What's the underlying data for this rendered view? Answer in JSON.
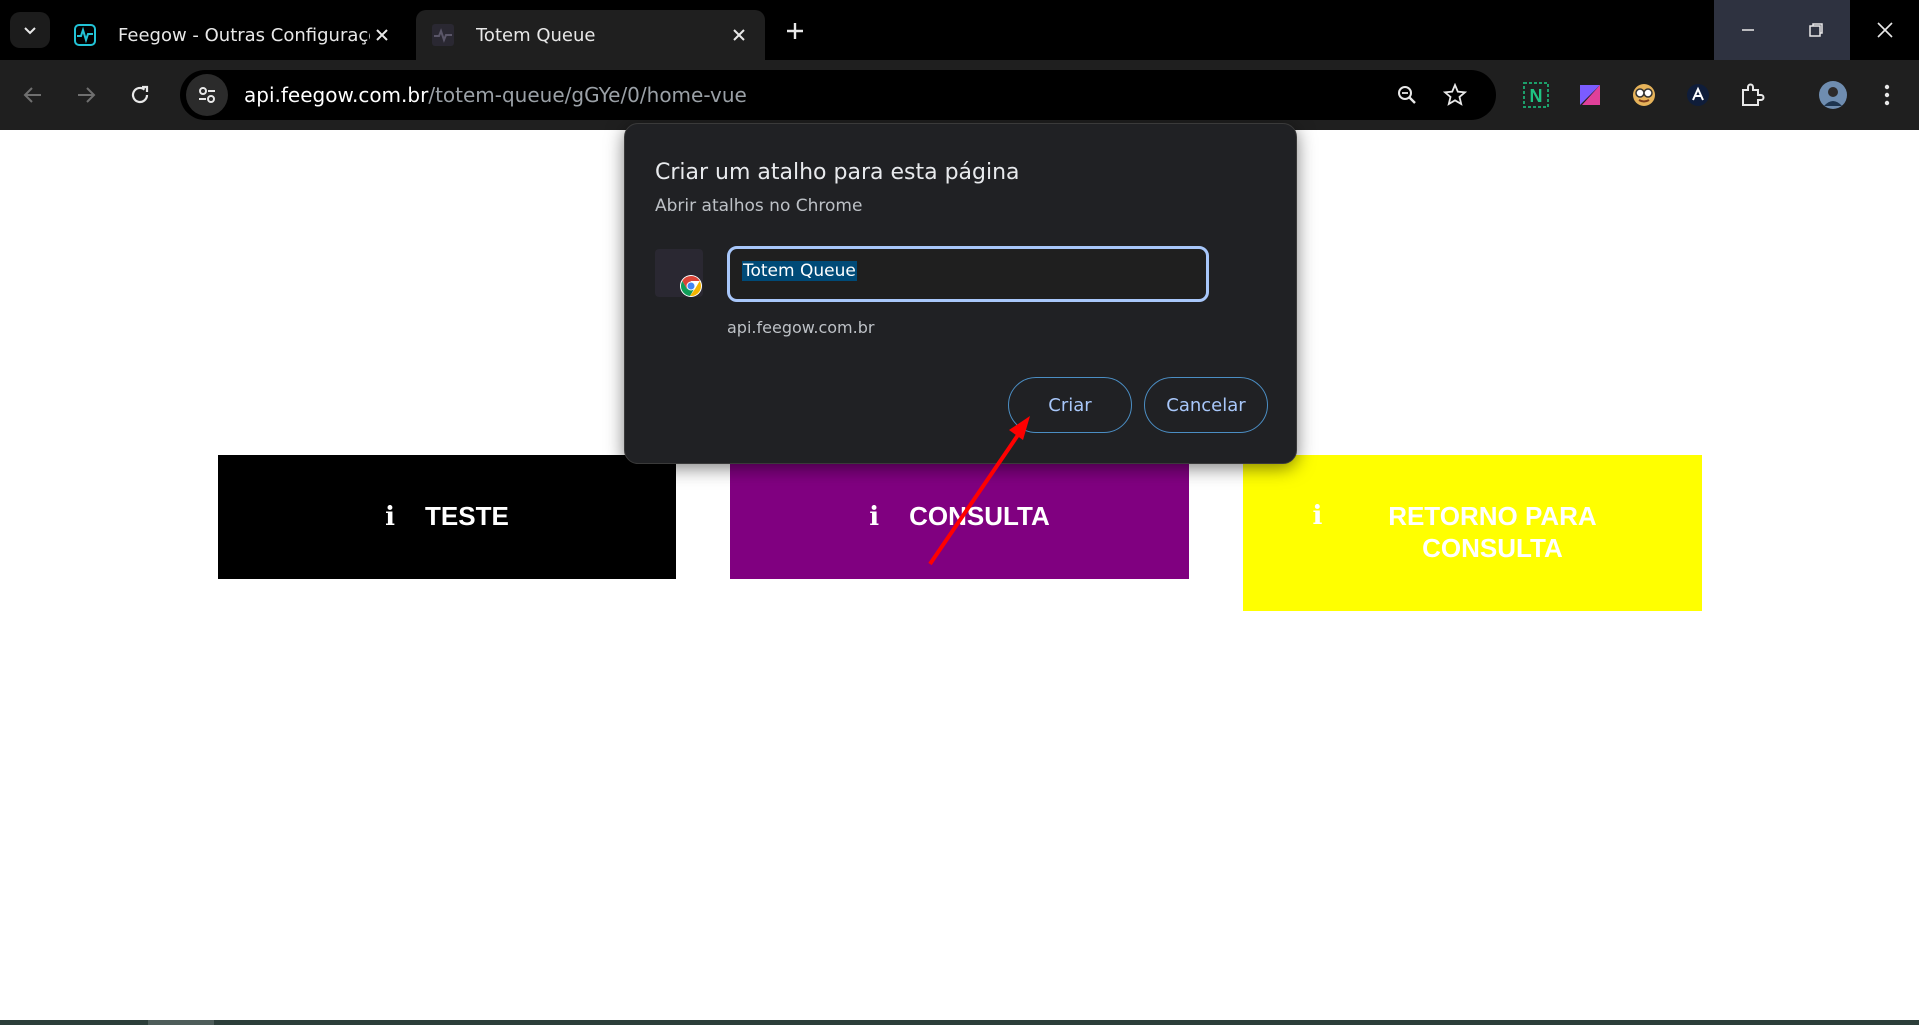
{
  "tabs": [
    {
      "title": "Feegow - Outras Configurações",
      "icon": "feegow-pulse-icon"
    },
    {
      "title": "Totem Queue",
      "icon": "totem-pulse-icon"
    }
  ],
  "address": {
    "host": "api.feegow.com.br",
    "path": "/totem-queue/gGYe/0/home-vue"
  },
  "page": {
    "buttons": [
      {
        "label": "TESTE",
        "icon": "info-icon",
        "color": "#000000"
      },
      {
        "label": "CONSULTA",
        "icon": "info-icon",
        "color": "#800080"
      },
      {
        "label": "RETORNO PARA CONSULTA",
        "icon": "info-icon",
        "color": "#ffff00"
      }
    ]
  },
  "dialog": {
    "title": "Criar um atalho para esta página",
    "subtitle": "Abrir atalhos no Chrome",
    "name_value": "Totem Queue",
    "domain": "api.feegow.com.br",
    "create_label": "Criar",
    "cancel_label": "Cancelar"
  },
  "colors": {
    "accent": "#a8c7fa",
    "annotation_arrow": "#ff0000"
  }
}
